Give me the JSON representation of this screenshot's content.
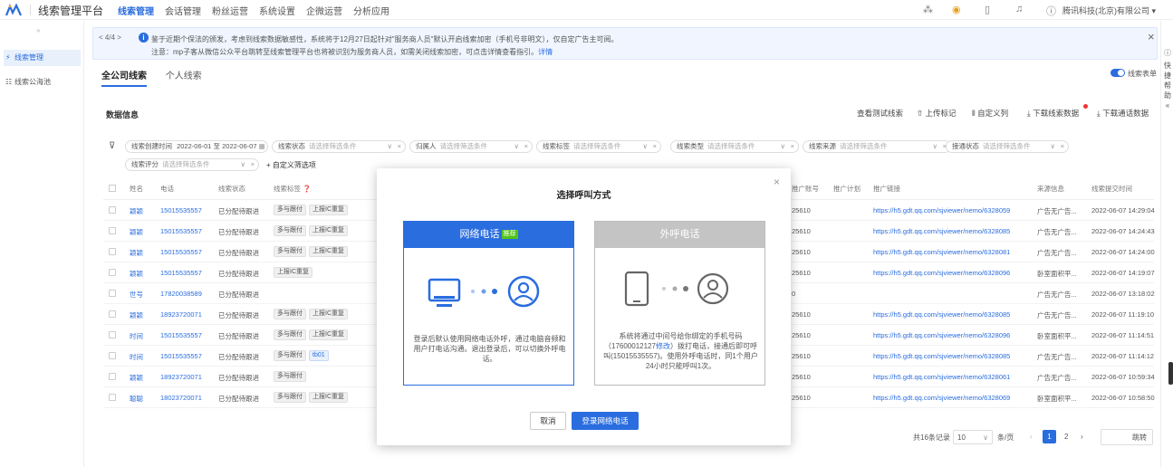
{
  "app": {
    "title": "线索管理平台"
  },
  "nav": [
    "线索管理",
    "会话管理",
    "粉丝运营",
    "系统设置",
    "企微运营",
    "分析应用"
  ],
  "header": {
    "company": "腾讯科技(北京)有限公司 ▾"
  },
  "sidebar": {
    "items": [
      "线索管理",
      "线索公海池"
    ]
  },
  "notice": {
    "pager": "< 4/4 >",
    "line1": "鉴于近期个保法的颁发，考虑到线索数据敏感性，系统将于12月27日起针对\"服务商人员\"默认开启线索加密（手机号非明文），仅自定广告主可阅。",
    "line2": "注意：mp子客从微信公众平台跳转至线索管理平台也将被识别为服务商人员，如需关闭线索加密，可点击详情查看指引。",
    "link": "详情"
  },
  "tabs": [
    "全公司线索",
    "个人线索"
  ],
  "toggle_label": "线索表单",
  "section_title": "数据信息",
  "actions": [
    "查看测试线索",
    "上传标记",
    "自定义列",
    "下载线索数据",
    "下载通话数据"
  ],
  "filters": [
    {
      "label": "线索创建时间",
      "value": "2022-06-01 至 2022-06-07"
    },
    {
      "label": "线索状态",
      "placeholder": "请选择筛选条件"
    },
    {
      "label": "归属人",
      "placeholder": "请选择筛选条件"
    },
    {
      "label": "线索标签",
      "placeholder": "请选择筛选条件"
    },
    {
      "label": "线索类型",
      "placeholder": "请选择筛选条件"
    },
    {
      "label": "线索来源",
      "placeholder": "请选择筛选条件"
    },
    {
      "label": "接通状态",
      "placeholder": "请选择筛选条件"
    },
    {
      "label": "线索评分",
      "placeholder": "请选择筛选条件"
    }
  ],
  "add_filter": "+ 自定义筛选项",
  "table": {
    "headers": [
      "姓名",
      "电话",
      "线索状态",
      "线索标签",
      "推广账号",
      "推广计划",
      "推广链接",
      "来源信息",
      "线索提交时间"
    ],
    "rows": [
      {
        "name": "颖颖",
        "phone": "15015535557",
        "status": "已分配待跟进",
        "tags": [
          "多与跟付",
          "上报IC重复"
        ],
        "acct": "25610",
        "link": "https://h5.gdt.qq.com/sjviewer/nemo/6328059",
        "src": "广告无广告...",
        "time": "2022-06-07 14:29:04"
      },
      {
        "name": "颖颖",
        "phone": "15015535557",
        "status": "已分配待跟进",
        "tags": [
          "多与跟付",
          "上报IC重复"
        ],
        "acct": "25610",
        "link": "https://h5.gdt.qq.com/sjviewer/nemo/6328085",
        "src": "广告无广告...",
        "time": "2022-06-07 14:24:43"
      },
      {
        "name": "颖颖",
        "phone": "15015535557",
        "status": "已分配待跟进",
        "tags": [
          "多与跟付",
          "上报IC重复"
        ],
        "acct": "25610",
        "link": "https://h5.gdt.qq.com/sjviewer/nemo/6328081",
        "src": "广告无广告...",
        "time": "2022-06-07 14:24:00"
      },
      {
        "name": "颖颖",
        "phone": "15015535557",
        "status": "已分配待跟进",
        "tags": [
          "上报IC重复"
        ],
        "acct": "25610",
        "link": "https://h5.gdt.qq.com/sjviewer/nemo/6328096",
        "src": "卧室面积平...",
        "time": "2022-06-07 14:19:07"
      },
      {
        "name": "世号",
        "phone": "17820038589",
        "status": "已分配待跟进",
        "tags": [],
        "acct": "0",
        "link": "",
        "src": "广告无广告...",
        "time": "2022-06-07 13:18:02"
      },
      {
        "name": "颖颖",
        "phone": "18923720071",
        "status": "已分配待跟进",
        "tags": [
          "多与跟付",
          "上报IC重复"
        ],
        "acct": "25610",
        "link": "https://h5.gdt.qq.com/sjviewer/nemo/6328085",
        "src": "广告无广告...",
        "time": "2022-06-07 11:19:10"
      },
      {
        "name": "时间",
        "phone": "15015535557",
        "status": "已分配待跟进",
        "tags": [
          "多与跟付",
          "上报IC重复"
        ],
        "acct": "25610",
        "link": "https://h5.gdt.qq.com/sjviewer/nemo/6328096",
        "src": "卧室面积平...",
        "time": "2022-06-07 11:14:51"
      },
      {
        "name": "时间",
        "phone": "15015535557",
        "status": "已分配待跟进",
        "tags": [
          "多与跟付",
          "tb01"
        ],
        "acct": "25610",
        "link": "https://h5.gdt.qq.com/sjviewer/nemo/6328085",
        "src": "广告无广告...",
        "time": "2022-06-07 11:14:12"
      },
      {
        "name": "颖颖",
        "phone": "18923720071",
        "status": "已分配待跟进",
        "tags": [
          "多与跟付"
        ],
        "acct": "25610",
        "link": "https://h5.gdt.qq.com/sjviewer/nemo/6328061",
        "src": "广告无广告...",
        "time": "2022-06-07 10:59:34"
      },
      {
        "name": "聪聪",
        "phone": "18023720071",
        "status": "已分配待跟进",
        "tags": [
          "多与跟付",
          "上报IC重复"
        ],
        "acct": "25610",
        "link": "https://h5.gdt.qq.com/sjviewer/nemo/6328069",
        "src": "卧室面积平...",
        "time": "2022-06-07 10:58:50"
      }
    ]
  },
  "pagination": {
    "total": "共16条记录",
    "size": "10",
    "unit": "条/页",
    "page1": "1",
    "page2": "2",
    "jump": "跳转"
  },
  "modal": {
    "title": "选择呼叫方式",
    "card1": {
      "title": "网络电话",
      "badge": "推荐",
      "desc": "登录后默认使用网络电话外呼，通过电脑音频和用户打电话沟通。退出登录后，可以切换外呼电话。"
    },
    "card2": {
      "title": "外呼电话",
      "desc_pre": "系统将通过中间号给你绑定的手机号码（17600012127",
      "desc_link": "修改",
      "desc_post": "）拨打电话，接通后即可呼叫(15015535557)。使用外呼电话时，同1个用户24小时只能呼叫1次。"
    },
    "cancel": "取消",
    "confirm": "登录网络电话"
  },
  "right_strip": "快捷帮助"
}
